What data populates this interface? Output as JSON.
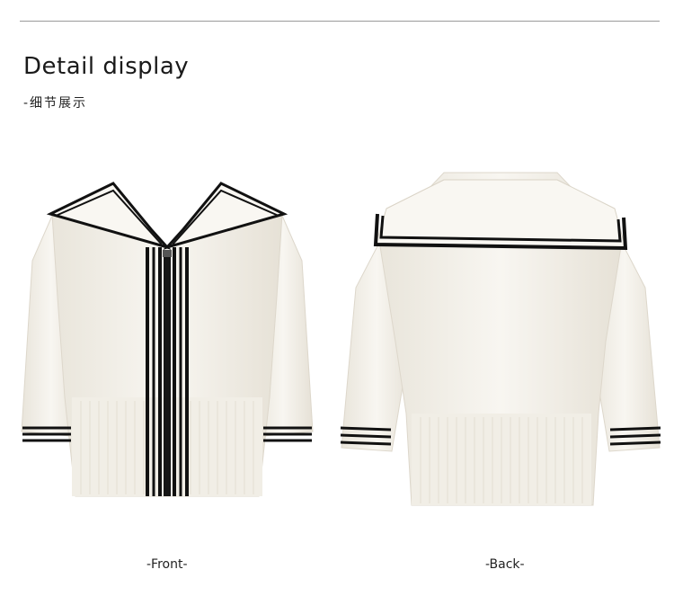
{
  "header": {
    "title": "Detail display",
    "subtitle": "-细节展示"
  },
  "views": [
    {
      "caption": "-Front-",
      "icon": "cardigan-front-image"
    },
    {
      "caption": "-Back-",
      "icon": "cardigan-back-image"
    }
  ],
  "colors": {
    "knit": "#f6f3ec",
    "knit_shadow": "#e4dfd4",
    "stripe": "#111111",
    "rule": "#9a9a9a"
  }
}
